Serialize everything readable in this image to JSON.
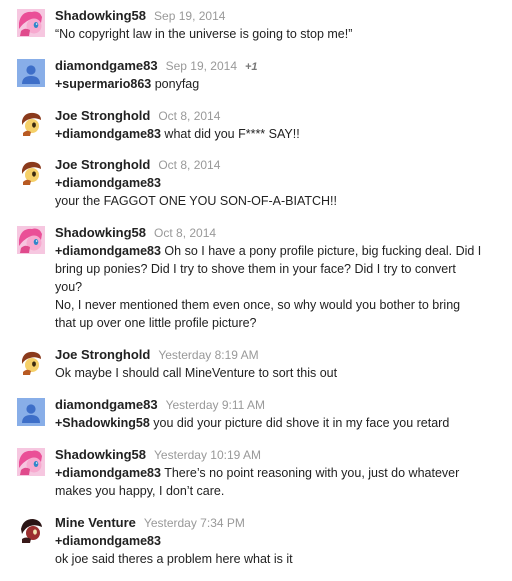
{
  "comments": [
    {
      "author": "Shadowking58",
      "date": "Sep 19, 2014",
      "avatar": "pink-pony-avatar",
      "lines": [
        {
          "text": "“No copyright law in the universe is going to stop me!”"
        }
      ]
    },
    {
      "author": "diamondgame83",
      "date": "Sep 19, 2014",
      "plus_one": "+1",
      "avatar": "default-person-avatar",
      "lines": [
        {
          "mention": "+supermario863",
          "text": " ponyfag"
        }
      ]
    },
    {
      "author": "Joe Stronghold",
      "date": "Oct 8, 2014",
      "avatar": "yellow-pony-avatar",
      "lines": [
        {
          "mention": "+diamondgame83",
          "text": " what did you F**** SAY!!"
        }
      ]
    },
    {
      "author": "Joe Stronghold",
      "date": "Oct 8, 2014",
      "avatar": "yellow-pony-avatar",
      "lines": [
        {
          "mention": "+diamondgame83"
        },
        {
          "text": "your the FAGGOT ONE YOU SON-OF-A-BIATCH!!"
        }
      ]
    },
    {
      "author": "Shadowking58",
      "date": "Oct 8, 2014",
      "avatar": "pink-pony-avatar",
      "lines": [
        {
          "mention": "+diamondgame83",
          "text": " Oh so I have a pony profile picture, big fucking deal. Did I"
        },
        {
          "text": "bring up ponies? Did I try to shove them in your face? Did I try to convert"
        },
        {
          "text": "you?"
        },
        {
          "text": "No, I never mentioned them even once, so why would you bother to bring"
        },
        {
          "text": "that up over one little profile picture?"
        }
      ]
    },
    {
      "author": "Joe Stronghold",
      "date": "Yesterday 8:19 AM",
      "avatar": "yellow-pony-avatar",
      "lines": [
        {
          "text": "Ok maybe I should call MineVenture to sort this out"
        }
      ]
    },
    {
      "author": "diamondgame83",
      "date": "Yesterday 9:11 AM",
      "avatar": "default-person-avatar",
      "lines": [
        {
          "mention": "+Shadowking58",
          "text": " you did your picture did shove it in my face you retard"
        }
      ]
    },
    {
      "author": "Shadowking58",
      "date": "Yesterday 10:19 AM",
      "avatar": "pink-pony-avatar",
      "lines": [
        {
          "mention": "+diamondgame83",
          "text": " There’s no point reasoning with you, just do whatever"
        },
        {
          "text": "makes you happy, I don’t care."
        }
      ]
    },
    {
      "author": "Mine Venture",
      "date": "Yesterday 7:34 PM",
      "avatar": "dark-pony-avatar",
      "lines": [
        {
          "mention": "+diamondgame83"
        },
        {
          "text": "ok joe said theres a problem here  what is it"
        }
      ]
    }
  ]
}
